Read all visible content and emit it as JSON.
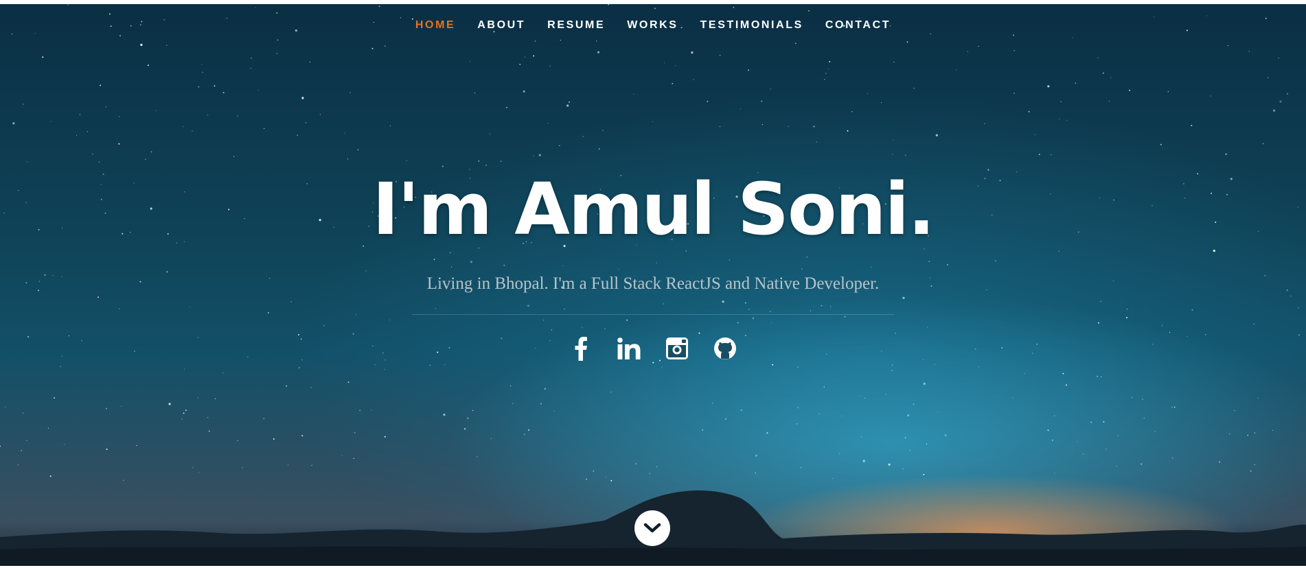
{
  "nav": {
    "items": [
      {
        "label": "HOME",
        "active": true
      },
      {
        "label": "ABOUT",
        "active": false
      },
      {
        "label": "RESUME",
        "active": false
      },
      {
        "label": "WORKS",
        "active": false
      },
      {
        "label": "TESTIMONIALS",
        "active": false
      },
      {
        "label": "CONTACT",
        "active": false
      }
    ]
  },
  "hero": {
    "headline": "I'm Amul Soni.",
    "subtitle": "Living in Bhopal. I'm a Full Stack ReactJS and Native Developer."
  },
  "social": [
    {
      "icon": "facebook-icon"
    },
    {
      "icon": "linkedin-icon"
    },
    {
      "icon": "instagram-icon"
    },
    {
      "icon": "github-icon"
    }
  ],
  "scroll": {
    "icon": "chevron-down-icon"
  },
  "colors": {
    "accent": "#e6731e",
    "text": "#ffffff",
    "subtitle": "#b8c3c9",
    "sky_top": "#0b2f44",
    "sky_glow": "#34aacd"
  }
}
